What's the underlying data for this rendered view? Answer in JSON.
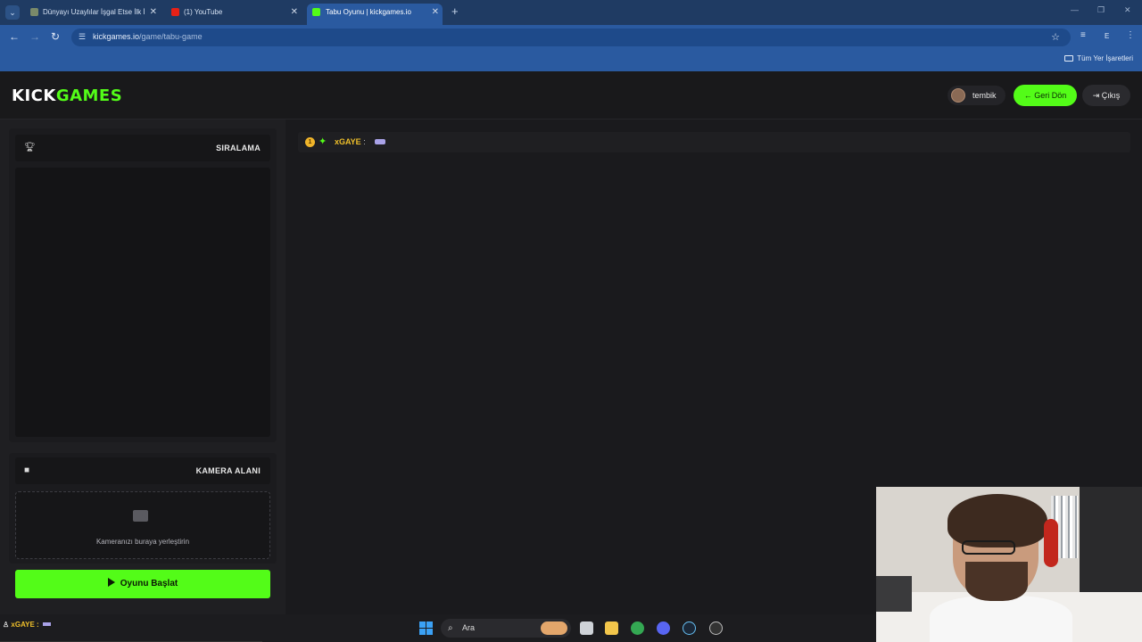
{
  "browser": {
    "tabs": [
      {
        "title": "Dünyayı Uzaylılar İşgal Etse İlk İ",
        "active": false
      },
      {
        "title": "(1) YouTube",
        "active": false
      },
      {
        "title": "Tabu Oyunu | kickgames.io",
        "active": true
      }
    ],
    "url_host": "kickgames.io",
    "url_path": "/game/tabu-game",
    "profile_initial": "E",
    "bookmarks_all": "Tüm Yer İşaretleri"
  },
  "header": {
    "logo_kick": "KICK",
    "logo_games": "GAMES",
    "username": "tembik",
    "back_label": "Geri Dön",
    "logout_label": "Çıkış"
  },
  "sidebar": {
    "leaderboard_title": "SIRALAMA",
    "camera_title": "KAMERA ALANI",
    "camera_hint": "Kameranızı buraya yerleştirin",
    "start_label": "Oyunu Başlat"
  },
  "main": {
    "chat": [
      {
        "rank_badge": "1",
        "user": "xGAYE",
        "sep": ":"
      }
    ]
  },
  "taskbar": {
    "mini_user": "xGAYE",
    "search_placeholder": "Ara"
  },
  "colors": {
    "accent": "#53fc18",
    "background": "#1a1a1d",
    "browser_blue": "#2a5aa0"
  }
}
